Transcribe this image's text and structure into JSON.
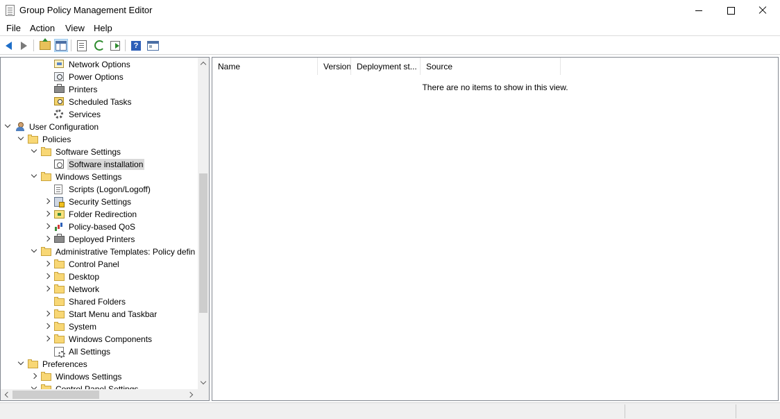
{
  "window": {
    "title": "Group Policy Management Editor"
  },
  "menu": [
    "File",
    "Action",
    "View",
    "Help"
  ],
  "toolbar": {
    "buttons": [
      {
        "name": "back-button",
        "icon": "back-arrow-icon"
      },
      {
        "name": "forward-button",
        "icon": "forward-arrow-icon"
      },
      {
        "name": "up-one-level-button",
        "icon": "folder-up-icon"
      },
      {
        "name": "show-hide-console-tree-button",
        "icon": "console-tree-icon",
        "pressed": true
      },
      {
        "name": "properties-button",
        "icon": "properties-icon"
      },
      {
        "name": "refresh-button",
        "icon": "refresh-icon"
      },
      {
        "name": "export-list-button",
        "icon": "export-list-icon"
      },
      {
        "name": "help-button",
        "icon": "help-icon"
      },
      {
        "name": "show-hide-action-pane-button",
        "icon": "action-pane-icon"
      }
    ]
  },
  "tree": {
    "items": [
      {
        "label": "Network Options",
        "indent": 4,
        "expander": "none",
        "icon": "network-options-icon"
      },
      {
        "label": "Power Options",
        "indent": 4,
        "expander": "none",
        "icon": "power-options-icon"
      },
      {
        "label": "Printers",
        "indent": 4,
        "expander": "none",
        "icon": "printer-icon"
      },
      {
        "label": "Scheduled Tasks",
        "indent": 4,
        "expander": "none",
        "icon": "scheduled-tasks-icon"
      },
      {
        "label": "Services",
        "indent": 4,
        "expander": "none",
        "icon": "gear-icon"
      },
      {
        "label": "User Configuration",
        "indent": 1,
        "expander": "expanded",
        "icon": "user-icon"
      },
      {
        "label": "Policies",
        "indent": 2,
        "expander": "expanded",
        "icon": "folder-icon"
      },
      {
        "label": "Software Settings",
        "indent": 3,
        "expander": "expanded",
        "icon": "folder-icon"
      },
      {
        "label": "Software installation",
        "indent": 4,
        "expander": "none",
        "icon": "software-installation-icon",
        "selected": true
      },
      {
        "label": "Windows Settings",
        "indent": 3,
        "expander": "expanded",
        "icon": "folder-icon"
      },
      {
        "label": "Scripts (Logon/Logoff)",
        "indent": 4,
        "expander": "none",
        "icon": "script-icon"
      },
      {
        "label": "Security Settings",
        "indent": 4,
        "expander": "collapsed",
        "icon": "security-settings-icon"
      },
      {
        "label": "Folder Redirection",
        "indent": 4,
        "expander": "collapsed",
        "icon": "folder-redirection-icon"
      },
      {
        "label": "Policy-based QoS",
        "indent": 4,
        "expander": "collapsed",
        "icon": "qos-chart-icon"
      },
      {
        "label": "Deployed Printers",
        "indent": 4,
        "expander": "collapsed",
        "icon": "printer-icon"
      },
      {
        "label": "Administrative Templates: Policy defin",
        "indent": 3,
        "expander": "expanded",
        "icon": "folder-icon"
      },
      {
        "label": "Control Panel",
        "indent": 4,
        "expander": "collapsed",
        "icon": "folder-icon"
      },
      {
        "label": "Desktop",
        "indent": 4,
        "expander": "collapsed",
        "icon": "folder-icon"
      },
      {
        "label": "Network",
        "indent": 4,
        "expander": "collapsed",
        "icon": "folder-icon"
      },
      {
        "label": "Shared Folders",
        "indent": 4,
        "expander": "none",
        "icon": "folder-icon"
      },
      {
        "label": "Start Menu and Taskbar",
        "indent": 4,
        "expander": "collapsed",
        "icon": "folder-icon"
      },
      {
        "label": "System",
        "indent": 4,
        "expander": "collapsed",
        "icon": "folder-icon"
      },
      {
        "label": "Windows Components",
        "indent": 4,
        "expander": "collapsed",
        "icon": "folder-icon"
      },
      {
        "label": "All Settings",
        "indent": 4,
        "expander": "none",
        "icon": "all-settings-icon"
      },
      {
        "label": "Preferences",
        "indent": 2,
        "expander": "expanded",
        "icon": "folder-icon"
      },
      {
        "label": "Windows Settings",
        "indent": 3,
        "expander": "collapsed",
        "icon": "folder-icon"
      },
      {
        "label": "Control Panel Settings",
        "indent": 3,
        "expander": "expanded",
        "icon": "folder-icon"
      }
    ]
  },
  "list": {
    "columns": [
      "Name",
      "Version",
      "Deployment st...",
      "Source"
    ],
    "empty_message": "There are no items to show in this view."
  }
}
